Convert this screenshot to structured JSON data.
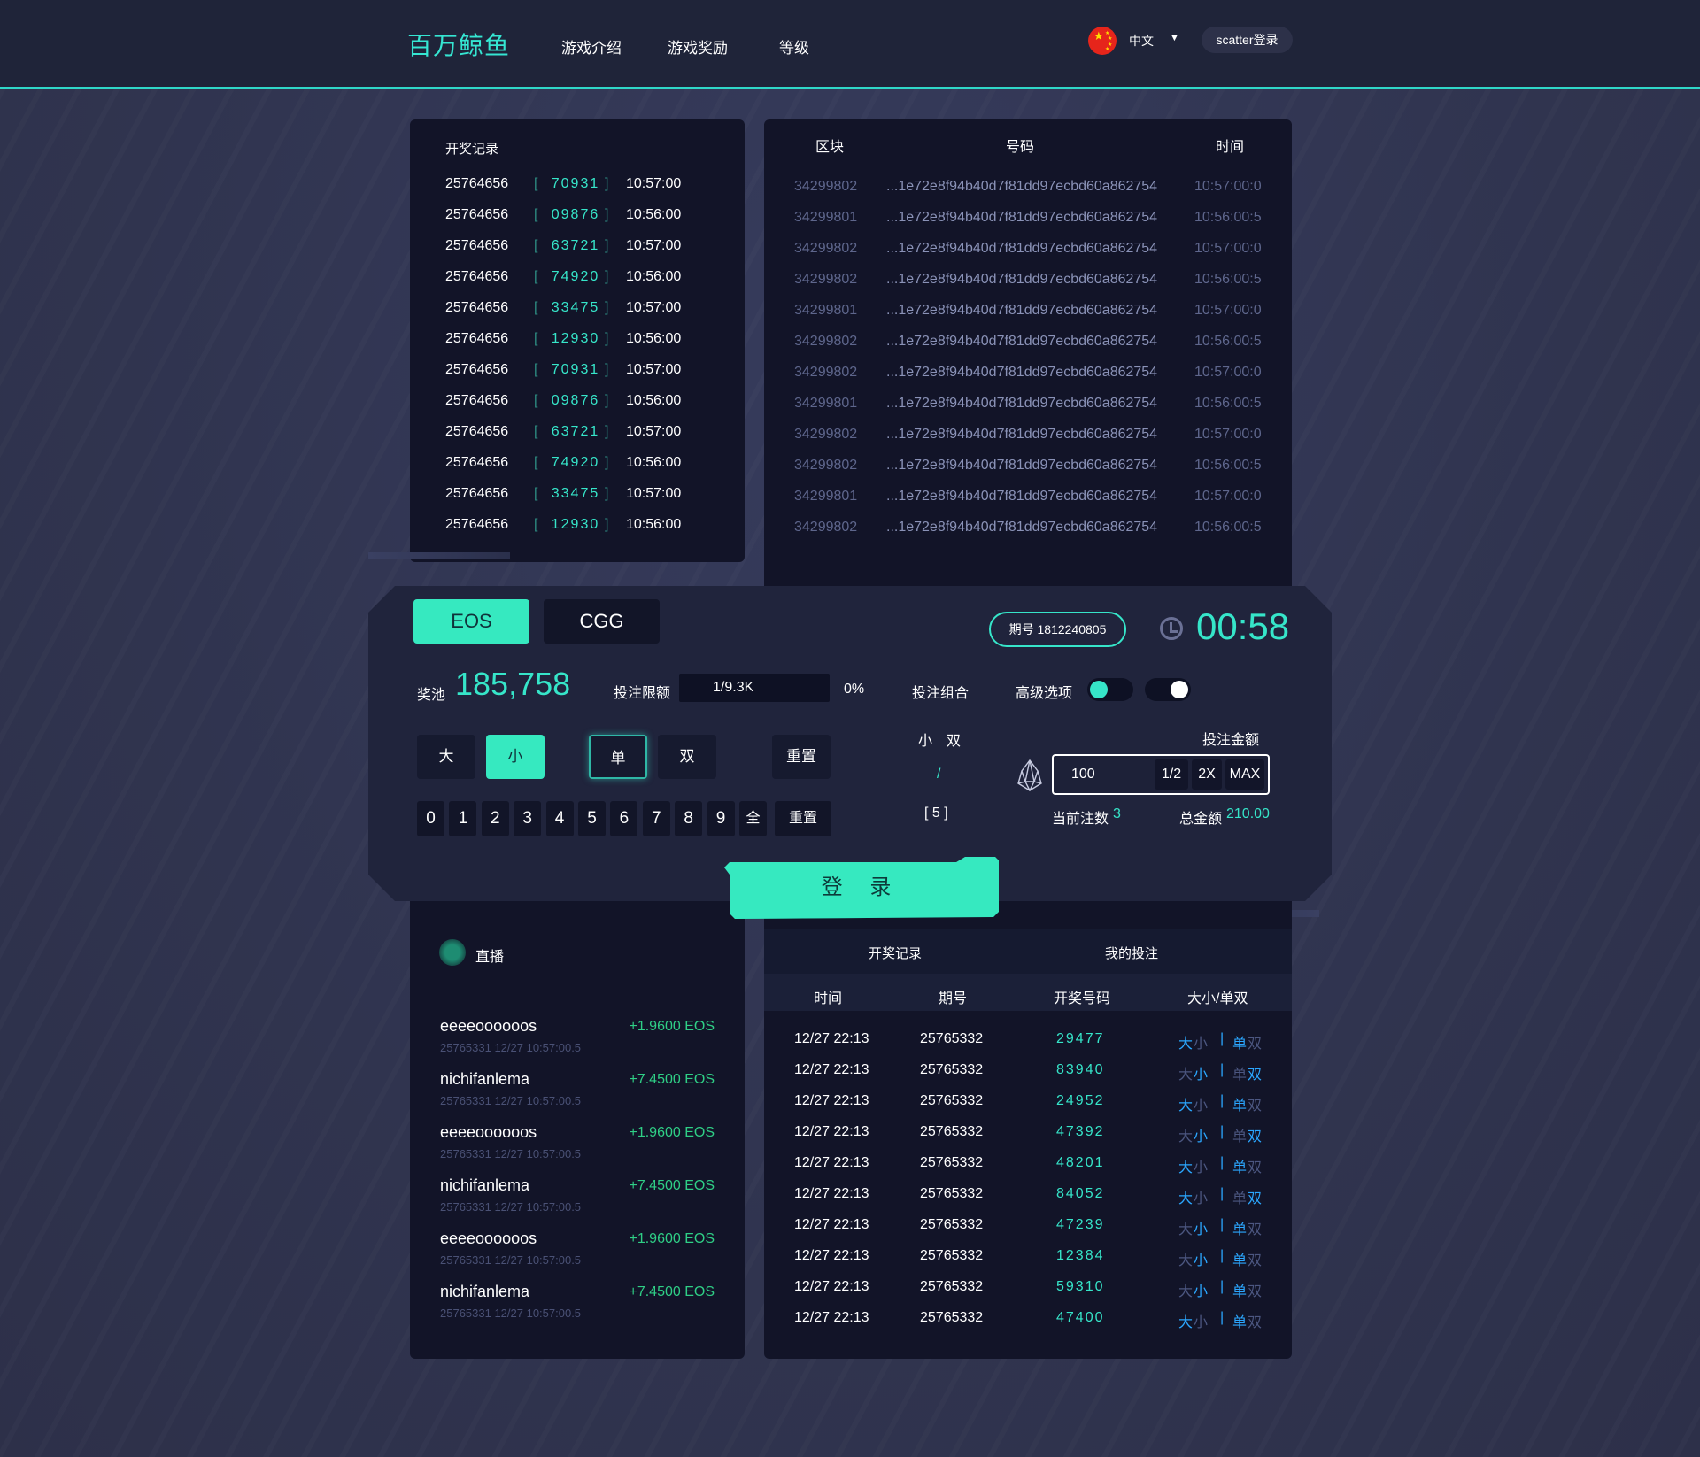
{
  "header": {
    "logo": "百万鲸鱼",
    "nav": [
      "游戏介绍",
      "游戏奖励",
      "等级"
    ],
    "language": "中文",
    "login_button": "scatter登录"
  },
  "draw_records": {
    "title": "开奖记录",
    "rows": [
      {
        "issue": "25764656",
        "num": "70931",
        "time": "10:57:00"
      },
      {
        "issue": "25764656",
        "num": "09876",
        "time": "10:56:00"
      },
      {
        "issue": "25764656",
        "num": "63721",
        "time": "10:57:00"
      },
      {
        "issue": "25764656",
        "num": "74920",
        "time": "10:56:00"
      },
      {
        "issue": "25764656",
        "num": "33475",
        "time": "10:57:00"
      },
      {
        "issue": "25764656",
        "num": "12930",
        "time": "10:56:00"
      },
      {
        "issue": "25764656",
        "num": "70931",
        "time": "10:57:00"
      },
      {
        "issue": "25764656",
        "num": "09876",
        "time": "10:56:00"
      },
      {
        "issue": "25764656",
        "num": "63721",
        "time": "10:57:00"
      },
      {
        "issue": "25764656",
        "num": "74920",
        "time": "10:56:00"
      },
      {
        "issue": "25764656",
        "num": "33475",
        "time": "10:57:00"
      },
      {
        "issue": "25764656",
        "num": "12930",
        "time": "10:56:00"
      }
    ]
  },
  "blocks": {
    "headers": [
      "区块",
      "号码",
      "时间"
    ],
    "rows": [
      {
        "block": "34299802",
        "hash": "...1e72e8f94b40d7f81dd97ecbd60a862754",
        "time": "10:57:00:0"
      },
      {
        "block": "34299801",
        "hash": "...1e72e8f94b40d7f81dd97ecbd60a862754",
        "time": "10:56:00:5"
      },
      {
        "block": "34299802",
        "hash": "...1e72e8f94b40d7f81dd97ecbd60a862754",
        "time": "10:57:00:0"
      },
      {
        "block": "34299802",
        "hash": "...1e72e8f94b40d7f81dd97ecbd60a862754",
        "time": "10:56:00:5"
      },
      {
        "block": "34299801",
        "hash": "...1e72e8f94b40d7f81dd97ecbd60a862754",
        "time": "10:57:00:0"
      },
      {
        "block": "34299802",
        "hash": "...1e72e8f94b40d7f81dd97ecbd60a862754",
        "time": "10:56:00:5"
      },
      {
        "block": "34299802",
        "hash": "...1e72e8f94b40d7f81dd97ecbd60a862754",
        "time": "10:57:00:0"
      },
      {
        "block": "34299801",
        "hash": "...1e72e8f94b40d7f81dd97ecbd60a862754",
        "time": "10:56:00:5"
      },
      {
        "block": "34299802",
        "hash": "...1e72e8f94b40d7f81dd97ecbd60a862754",
        "time": "10:57:00:0"
      },
      {
        "block": "34299802",
        "hash": "...1e72e8f94b40d7f81dd97ecbd60a862754",
        "time": "10:56:00:5"
      },
      {
        "block": "34299801",
        "hash": "...1e72e8f94b40d7f81dd97ecbd60a862754",
        "time": "10:57:00:0"
      },
      {
        "block": "34299802",
        "hash": "...1e72e8f94b40d7f81dd97ecbd60a862754",
        "time": "10:56:00:5"
      }
    ]
  },
  "betting": {
    "currency_tabs": [
      "EOS",
      "CGG"
    ],
    "issue_label": "期号 1812240805",
    "countdown": "00:58",
    "pool_label": "奖池",
    "pool_value": "185,758",
    "limit_label": "投注限额",
    "limit_value": "1/9.3K",
    "limit_percent": "0%",
    "combo_label": "投注组合",
    "advanced_label": "高级选项",
    "big": "大",
    "small": "小",
    "odd": "单",
    "even": "双",
    "reset": "重置",
    "digits": [
      "0",
      "1",
      "2",
      "3",
      "4",
      "5",
      "6",
      "7",
      "8",
      "9",
      "全"
    ],
    "combo_small": "小",
    "combo_even": "双",
    "combo_slash": "/",
    "combo_bracket": "[ 5 ]",
    "amount_label": "投注金额",
    "amount_value": "100",
    "half": "1/2",
    "double": "2X",
    "max": "MAX",
    "current_bets_label": "当前注数",
    "current_bets_value": "3",
    "total_label": "总金额",
    "total_value": "210.00",
    "login": "登 录",
    "colors": {
      "accent": "#36e5c9",
      "button": "#36e9c0"
    }
  },
  "live": {
    "title": "直播",
    "items": [
      {
        "user": "eeeeoooooos",
        "amount": "+1.9600 EOS",
        "meta": "25765331  12/27 10:57:00.5"
      },
      {
        "user": "nichifanlema",
        "amount": "+7.4500 EOS",
        "meta": "25765331  12/27 10:57:00.5"
      },
      {
        "user": "eeeeoooooos",
        "amount": "+1.9600 EOS",
        "meta": "25765331  12/27 10:57:00.5"
      },
      {
        "user": "nichifanlema",
        "amount": "+7.4500 EOS",
        "meta": "25765331  12/27 10:57:00.5"
      },
      {
        "user": "eeeeoooooos",
        "amount": "+1.9600 EOS",
        "meta": "25765331  12/27 10:57:00.5"
      },
      {
        "user": "nichifanlema",
        "amount": "+7.4500 EOS",
        "meta": "25765331  12/27 10:57:00.5"
      }
    ]
  },
  "history": {
    "tabs": [
      "开奖记录",
      "我的投注"
    ],
    "headers": [
      "时间",
      "期号",
      "开奖号码",
      "大小/单双"
    ],
    "rows": [
      {
        "time": "12/27  22:13",
        "issue": "25765332",
        "num": "29477",
        "big_lit": true,
        "odd_lit": true
      },
      {
        "time": "12/27  22:13",
        "issue": "25765332",
        "num": "83940",
        "big_lit": false,
        "odd_lit": false
      },
      {
        "time": "12/27  22:13",
        "issue": "25765332",
        "num": "24952",
        "big_lit": true,
        "odd_lit": true
      },
      {
        "time": "12/27  22:13",
        "issue": "25765332",
        "num": "47392",
        "big_lit": false,
        "odd_lit": false
      },
      {
        "time": "12/27  22:13",
        "issue": "25765332",
        "num": "48201",
        "big_lit": true,
        "odd_lit": true
      },
      {
        "time": "12/27  22:13",
        "issue": "25765332",
        "num": "84052",
        "big_lit": true,
        "odd_lit": false
      },
      {
        "time": "12/27  22:13",
        "issue": "25765332",
        "num": "47239",
        "big_lit": false,
        "odd_lit": true
      },
      {
        "time": "12/27  22:13",
        "issue": "25765332",
        "num": "12384",
        "big_lit": false,
        "odd_lit": true
      },
      {
        "time": "12/27  22:13",
        "issue": "25765332",
        "num": "59310",
        "big_lit": false,
        "odd_lit": true
      },
      {
        "time": "12/27  22:13",
        "issue": "25765332",
        "num": "47400",
        "big_lit": true,
        "odd_lit": true
      }
    ],
    "big": "大",
    "small": "小",
    "odd": "单",
    "even": "双",
    "separator": "|"
  }
}
